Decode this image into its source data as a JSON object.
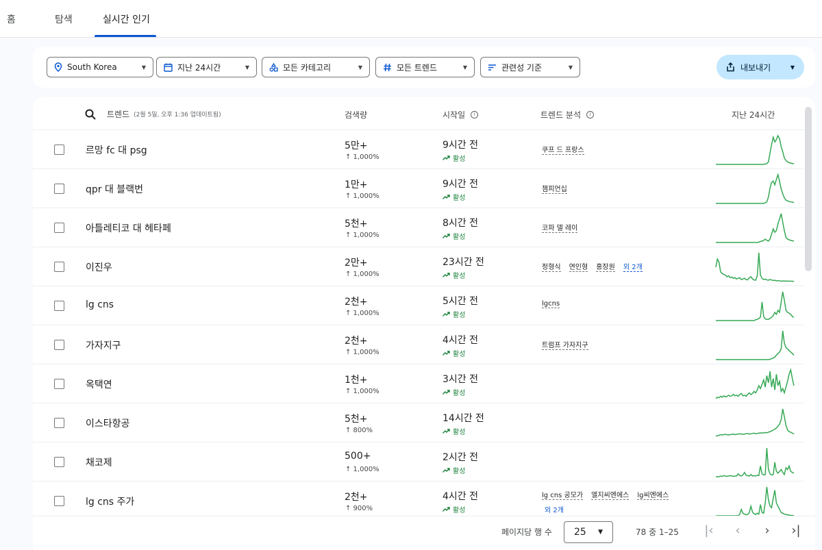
{
  "nav": {
    "tabs": [
      "홈",
      "탐색",
      "실시간 인기"
    ],
    "active": 2
  },
  "filters": {
    "region": "South Korea",
    "time": "지난 24시간",
    "category": "모든 카테고리",
    "trend_type": "모든 트렌드",
    "sort": "관련성 기준",
    "export": "내보내기"
  },
  "table": {
    "headers": {
      "trend": "트렌드",
      "updated": "(2월 5일, 오후 1:36 업데이트됨)",
      "volume": "검색량",
      "started": "시작일",
      "breakdown": "트렌드 분석",
      "last24": "지난 24시간"
    },
    "status_label": "활성",
    "rows": [
      {
        "name": "르망 fc 대 psg",
        "volume": "5만+",
        "growth": "↑ 1,000%",
        "started": "9시간 전",
        "breakdown": [
          "쿠프 드 프랑스"
        ],
        "more": "",
        "spark": [
          0,
          0,
          0,
          0,
          0,
          0,
          0,
          0,
          0,
          0,
          0,
          0,
          0,
          0,
          0,
          0,
          0,
          0,
          0,
          0,
          0,
          0,
          0,
          0,
          0,
          0,
          0,
          0,
          0,
          0,
          0,
          1,
          2,
          8,
          35,
          62,
          85,
          70,
          78,
          90,
          80,
          55,
          40,
          20,
          12,
          8,
          5,
          4,
          3,
          2
        ]
      },
      {
        "name": "qpr 대 블랙번",
        "volume": "1만+",
        "growth": "↑ 1,000%",
        "started": "9시간 전",
        "breakdown": [
          "챔피언십"
        ],
        "more": "",
        "spark": [
          0,
          0,
          0,
          0,
          0,
          0,
          0,
          0,
          0,
          0,
          0,
          0,
          0,
          0,
          0,
          0,
          0,
          0,
          0,
          0,
          0,
          0,
          0,
          0,
          0,
          0,
          0,
          0,
          0,
          0,
          0,
          2,
          5,
          20,
          48,
          66,
          70,
          58,
          75,
          90,
          68,
          45,
          30,
          18,
          10,
          8,
          6,
          5,
          4,
          3
        ]
      },
      {
        "name": "아틀레티코 대 헤타페",
        "volume": "5천+",
        "growth": "↑ 1,000%",
        "started": "8시간 전",
        "breakdown": [
          "코파 델 레이"
        ],
        "more": "",
        "spark": [
          0,
          0,
          0,
          0,
          0,
          0,
          0,
          0,
          0,
          0,
          0,
          0,
          0,
          0,
          0,
          0,
          0,
          0,
          0,
          0,
          0,
          0,
          0,
          0,
          0,
          0,
          0,
          1,
          3,
          4,
          6,
          10,
          6,
          4,
          10,
          25,
          40,
          30,
          35,
          55,
          70,
          85,
          60,
          35,
          15,
          10,
          8,
          6,
          5,
          4
        ]
      },
      {
        "name": "이진우",
        "volume": "2만+",
        "growth": "↑ 1,000%",
        "started": "23시간 전",
        "breakdown": [
          "정형식",
          "연인형",
          "홍장원"
        ],
        "more": "외 2개",
        "spark": [
          45,
          70,
          60,
          30,
          25,
          22,
          20,
          15,
          18,
          12,
          14,
          10,
          12,
          8,
          10,
          12,
          6,
          8,
          10,
          6,
          5,
          12,
          15,
          8,
          5,
          4,
          18,
          90,
          20,
          10,
          6,
          8,
          5,
          4,
          6,
          5,
          3,
          4,
          2,
          3,
          2,
          1,
          2,
          1,
          2,
          1,
          1,
          1,
          1,
          0
        ]
      },
      {
        "name": "lg cns",
        "volume": "2천+",
        "growth": "↑ 1,000%",
        "started": "5시간 전",
        "breakdown": [
          "lgcns"
        ],
        "more": "",
        "spark": [
          0,
          0,
          0,
          0,
          0,
          0,
          0,
          0,
          0,
          0,
          0,
          0,
          0,
          0,
          0,
          0,
          0,
          0,
          0,
          0,
          0,
          0,
          0,
          0,
          0,
          2,
          3,
          5,
          8,
          45,
          10,
          4,
          3,
          3,
          5,
          8,
          12,
          20,
          15,
          25,
          20,
          45,
          70,
          50,
          25,
          20,
          18,
          15,
          10,
          8
        ]
      },
      {
        "name": "가자지구",
        "volume": "2천+",
        "growth": "↑ 1,000%",
        "started": "4시간 전",
        "breakdown": [
          "트럼프 가자지구"
        ],
        "more": "",
        "spark": [
          0,
          0,
          0,
          0,
          0,
          0,
          0,
          0,
          0,
          0,
          0,
          0,
          0,
          0,
          0,
          0,
          0,
          0,
          0,
          0,
          0,
          0,
          0,
          0,
          0,
          0,
          0,
          0,
          0,
          0,
          0,
          0,
          0,
          0,
          1,
          3,
          5,
          8,
          15,
          20,
          25,
          35,
          95,
          55,
          40,
          35,
          30,
          25,
          20,
          15
        ]
      },
      {
        "name": "옥택연",
        "volume": "1천+",
        "growth": "↑ 1,000%",
        "started": "3시간 전",
        "breakdown": [],
        "more": "",
        "spark": [
          0,
          5,
          3,
          8,
          5,
          10,
          6,
          8,
          12,
          8,
          10,
          15,
          10,
          12,
          8,
          14,
          18,
          10,
          12,
          8,
          15,
          20,
          14,
          18,
          25,
          20,
          30,
          45,
          35,
          50,
          65,
          40,
          80,
          55,
          95,
          40,
          70,
          30,
          85,
          45,
          60,
          25,
          35,
          20,
          40,
          60,
          85,
          100,
          70,
          45
        ]
      },
      {
        "name": "이스타항공",
        "volume": "5천+",
        "growth": "↑ 800%",
        "started": "14시간 전",
        "breakdown": [],
        "more": "",
        "spark": [
          5,
          6,
          8,
          10,
          9,
          10,
          11,
          10,
          9,
          10,
          11,
          12,
          10,
          11,
          12,
          13,
          12,
          11,
          12,
          13,
          14,
          12,
          13,
          14,
          15,
          13,
          14,
          15,
          16,
          15,
          16,
          17,
          16,
          18,
          20,
          22,
          25,
          28,
          32,
          38,
          45,
          60,
          95,
          70,
          40,
          25,
          20,
          18,
          15,
          12
        ]
      },
      {
        "name": "채코제",
        "volume": "500+",
        "growth": "↑ 1,000%",
        "started": "2시간 전",
        "breakdown": [],
        "more": "",
        "spark": [
          0,
          0,
          0,
          2,
          1,
          3,
          2,
          1,
          2,
          3,
          2,
          1,
          2,
          2,
          8,
          3,
          2,
          5,
          12,
          4,
          3,
          2,
          6,
          2,
          3,
          2,
          4,
          3,
          30,
          8,
          5,
          6,
          80,
          20,
          8,
          5,
          6,
          40,
          15,
          10,
          15,
          20,
          12,
          6,
          25,
          20,
          30,
          15,
          12,
          10
        ]
      },
      {
        "name": "lg cns 주가",
        "volume": "2천+",
        "growth": "↑ 900%",
        "started": "4시간 전",
        "breakdown": [
          "lg cns 공모가",
          "엘지씨엔에스",
          "lg씨엔에스"
        ],
        "more": "외 2개",
        "spark": [
          0,
          0,
          0,
          0,
          0,
          0,
          0,
          0,
          0,
          0,
          0,
          0,
          0,
          0,
          0,
          5,
          20,
          8,
          5,
          3,
          4,
          10,
          30,
          12,
          6,
          4,
          8,
          5,
          35,
          10,
          8,
          40,
          90,
          50,
          30,
          25,
          55,
          80,
          40,
          30,
          20,
          10,
          8,
          5,
          4,
          3,
          2,
          1,
          1,
          0
        ]
      }
    ]
  },
  "pagination": {
    "rows_label": "페이지당 행 수",
    "rows_per_page": "25",
    "range": "78 중 1–25"
  },
  "colors": {
    "accent": "#0b57d0",
    "spark": "#34a853",
    "active_status": "#188038"
  }
}
